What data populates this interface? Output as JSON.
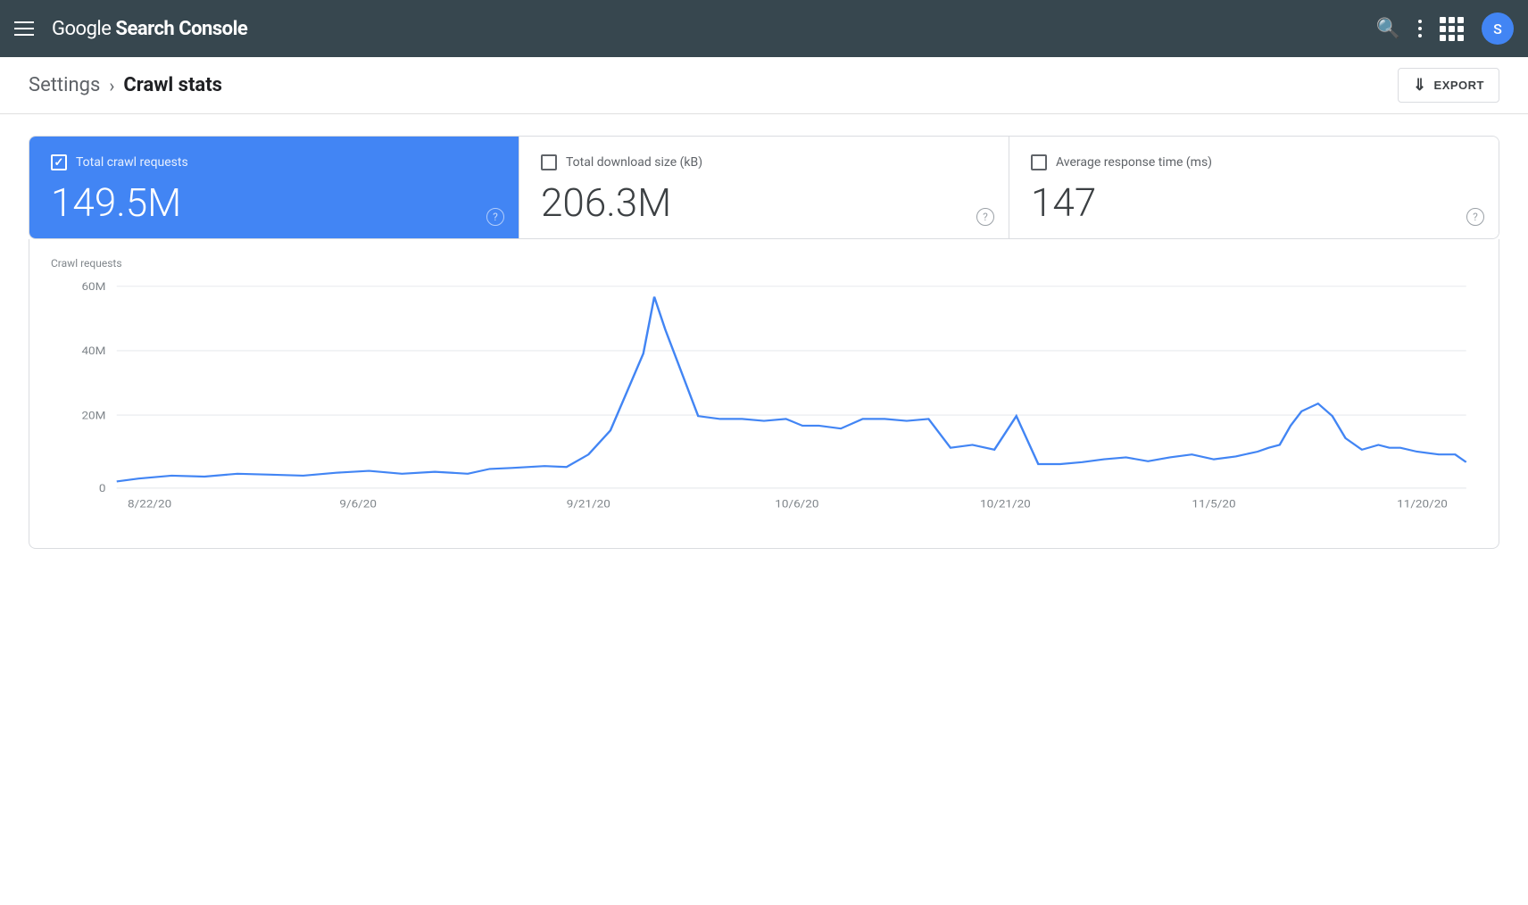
{
  "header": {
    "title": "Google Search Console",
    "title_plain": "Google",
    "title_bold": "Search Console",
    "avatar_letter": "S",
    "search_label": "Search",
    "more_label": "More options",
    "apps_label": "Google apps"
  },
  "breadcrumb": {
    "parent": "Settings",
    "separator": "›",
    "current": "Crawl stats",
    "export_label": "EXPORT"
  },
  "metrics": [
    {
      "id": "crawl_requests",
      "label": "Total crawl requests",
      "value": "149.5M",
      "active": true,
      "checked": true
    },
    {
      "id": "download_size",
      "label": "Total download size (kB)",
      "value": "206.3M",
      "active": false,
      "checked": false
    },
    {
      "id": "response_time",
      "label": "Average response time (ms)",
      "value": "147",
      "active": false,
      "checked": false
    }
  ],
  "chart": {
    "label": "Crawl requests",
    "y_axis": [
      "60M",
      "40M",
      "20M",
      "0"
    ],
    "x_axis": [
      "8/22/20",
      "9/6/20",
      "9/21/20",
      "10/6/20",
      "10/21/20",
      "11/5/20",
      "11/20/20"
    ],
    "accent_color": "#4285f4"
  }
}
